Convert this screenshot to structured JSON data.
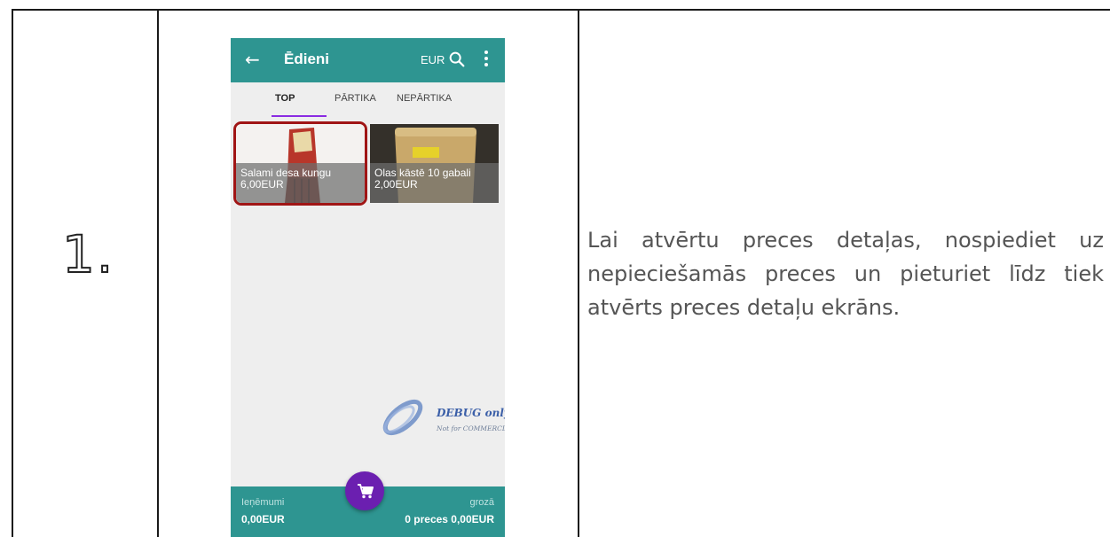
{
  "step": {
    "number": "1."
  },
  "description": "Lai atvērtu preces detaļas, nospiediet uz nepieciešamās preces un pieturiet līdz tiek atvērts preces detaļu ekrāns.",
  "phone": {
    "appbar": {
      "back_icon": "arrow-left-icon",
      "title": "Ēdieni",
      "currency": "EUR",
      "search_icon": "search-icon",
      "more_icon": "more-vertical-icon"
    },
    "tabs": [
      {
        "label": "TOP",
        "active": true
      },
      {
        "label": "PĀRTIKA",
        "active": false
      },
      {
        "label": "NEPĀRTIKA",
        "active": false
      }
    ],
    "products": [
      {
        "name": "Salami desa kungu",
        "price": "6,00EUR",
        "selected": true
      },
      {
        "name": "Olas kāstē 10 gabali",
        "price": "2,00EUR",
        "selected": false
      }
    ],
    "watermark": {
      "line1": "DEBUG only",
      "line2": "Not for COMMERCIAL"
    },
    "bottombar": {
      "left_label": "Ieņēmumi",
      "left_value": "0,00EUR",
      "right_label": "grozā",
      "right_value": "0 preces 0,00EUR",
      "fab_icon": "shopping-cart-icon"
    },
    "colors": {
      "primary": "#2e9591",
      "accent": "#6b1fb0",
      "selected_border": "#a01515"
    }
  }
}
